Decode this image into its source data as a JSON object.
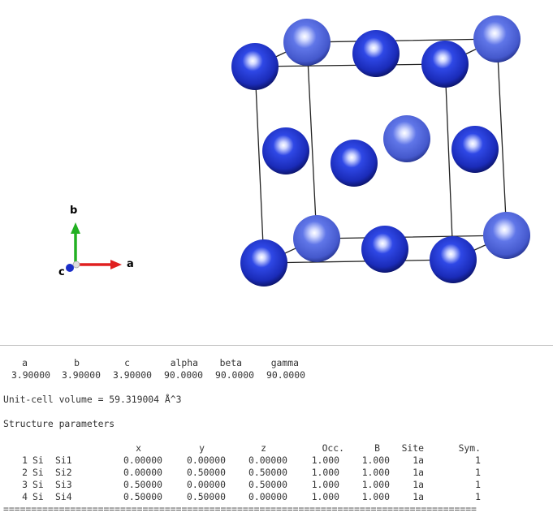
{
  "axes": {
    "a": "a",
    "b": "b",
    "c": "c"
  },
  "colors": {
    "atom_dark": "#1a2ec8",
    "atom_light": "#4a62d8",
    "axis_a": "#e02020",
    "axis_b": "#22b022",
    "axis_c": "#1a2ec8"
  },
  "lattice": {
    "headers": [
      "a",
      "b",
      "c",
      "alpha",
      "beta",
      "gamma"
    ],
    "values": [
      "3.90000",
      "3.90000",
      "3.90000",
      "90.0000",
      "90.0000",
      "90.0000"
    ]
  },
  "volume_text": "Unit-cell volume = 59.319004 Å^3",
  "structure_title": "Structure parameters",
  "table": {
    "headers": [
      "x",
      "y",
      "z",
      "Occ.",
      "B",
      "Site",
      "Sym."
    ],
    "rows": [
      {
        "n": "1",
        "el": "Si",
        "label": "Si1",
        "x": "0.00000",
        "y": "0.00000",
        "z": "0.00000",
        "occ": "1.000",
        "b": "1.000",
        "site": "1a",
        "sym": "1"
      },
      {
        "n": "2",
        "el": "Si",
        "label": "Si2",
        "x": "0.00000",
        "y": "0.50000",
        "z": "0.50000",
        "occ": "1.000",
        "b": "1.000",
        "site": "1a",
        "sym": "1"
      },
      {
        "n": "3",
        "el": "Si",
        "label": "Si3",
        "x": "0.50000",
        "y": "0.00000",
        "z": "0.50000",
        "occ": "1.000",
        "b": "1.000",
        "site": "1a",
        "sym": "1"
      },
      {
        "n": "4",
        "el": "Si",
        "label": "Si4",
        "x": "0.50000",
        "y": "0.50000",
        "z": "0.00000",
        "occ": "1.000",
        "b": "1.000",
        "site": "1a",
        "sym": "1"
      }
    ]
  },
  "separator": "====================================================================================="
}
